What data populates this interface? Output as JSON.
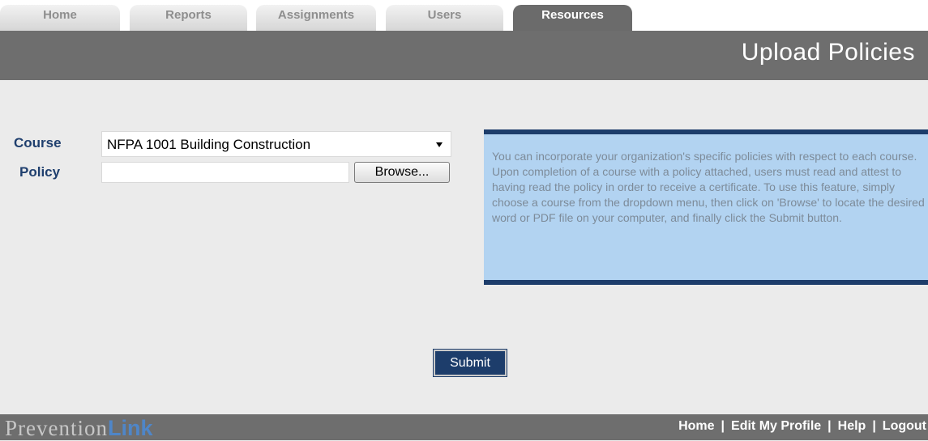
{
  "tabs": [
    {
      "label": "Home"
    },
    {
      "label": "Reports"
    },
    {
      "label": "Assignments"
    },
    {
      "label": "Users"
    },
    {
      "label": "Resources"
    }
  ],
  "header": {
    "title": "Upload Policies"
  },
  "form": {
    "course_label": "Course",
    "course_value": "NFPA 1001 Building Construction",
    "policy_label": "Policy",
    "policy_value": "",
    "browse_label": "Browse..."
  },
  "info": {
    "text": "You can incorporate your organization's specific policies with respect to each course. Upon completion of a course with a policy attached, users must read and attest to having read the policy in order to receive a certificate. To use this feature, simply choose a course from the dropdown menu, then click on 'Browse' to locate the desired word or PDF file on your computer, and finally click the Submit button."
  },
  "submit": {
    "label": "Submit"
  },
  "footer": {
    "logo_part1": "Prevention",
    "logo_part2": "Link",
    "links": [
      {
        "label": "Home"
      },
      {
        "label": "Edit My Profile"
      },
      {
        "label": "Help"
      },
      {
        "label": "Logout"
      }
    ]
  },
  "colors": {
    "navy": "#1d3d6b",
    "header_gray": "#6e6e6e",
    "info_blue": "#b2d3f1",
    "page_bg": "#ebebeb"
  }
}
